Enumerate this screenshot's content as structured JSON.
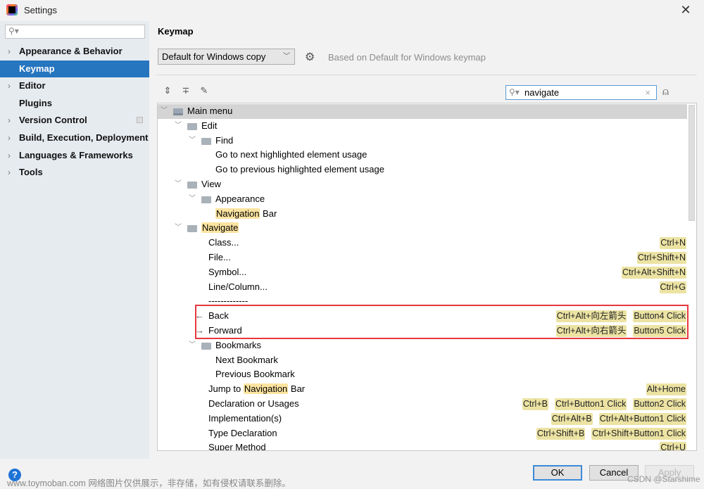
{
  "window": {
    "title": "Settings",
    "close_icon": "close-icon"
  },
  "sidebar": {
    "search_placeholder": "",
    "items": [
      {
        "label": "Appearance & Behavior",
        "expandable": true,
        "selected": false
      },
      {
        "label": "Keymap",
        "expandable": false,
        "selected": true
      },
      {
        "label": "Editor",
        "expandable": true,
        "selected": false
      },
      {
        "label": "Plugins",
        "expandable": false,
        "selected": false
      },
      {
        "label": "Version Control",
        "expandable": true,
        "selected": false,
        "has_project_icon": true
      },
      {
        "label": "Build, Execution, Deployment",
        "expandable": true,
        "selected": false
      },
      {
        "label": "Languages & Frameworks",
        "expandable": true,
        "selected": false
      },
      {
        "label": "Tools",
        "expandable": true,
        "selected": false
      }
    ]
  },
  "main": {
    "title": "Keymap",
    "keymap_select": "Default for Windows copy",
    "based_on": "Based on Default for Windows keymap",
    "filter": {
      "value": "navigate",
      "placeholder": ""
    },
    "tool_icons": [
      "expand-all-icon",
      "collapse-all-icon",
      "edit-icon"
    ],
    "tree": [
      {
        "depth": 0,
        "toggle": true,
        "folder": "main",
        "parts": [
          {
            "t": "Main menu"
          }
        ],
        "selected": true
      },
      {
        "depth": 1,
        "toggle": true,
        "folder": "folder",
        "parts": [
          {
            "t": "Edit"
          }
        ]
      },
      {
        "depth": 2,
        "toggle": true,
        "folder": "folder",
        "parts": [
          {
            "t": "Find"
          }
        ]
      },
      {
        "depth": 3,
        "parts": [
          {
            "t": "Go to next highlighted element usage"
          }
        ]
      },
      {
        "depth": 3,
        "parts": [
          {
            "t": "Go to previous highlighted element usage"
          }
        ]
      },
      {
        "depth": 1,
        "toggle": true,
        "folder": "folder",
        "parts": [
          {
            "t": "View"
          }
        ]
      },
      {
        "depth": 2,
        "toggle": true,
        "folder": "folder",
        "parts": [
          {
            "t": "Appearance"
          }
        ]
      },
      {
        "depth": 3,
        "parts": [
          {
            "t": "Navigation",
            "hl": true
          },
          {
            "t": " Bar"
          }
        ]
      },
      {
        "depth": 1,
        "toggle": true,
        "folder": "folder",
        "parts": [
          {
            "t": "Navigate",
            "hl": true
          }
        ]
      },
      {
        "depth": 2.5,
        "parts": [
          {
            "t": "Class..."
          }
        ],
        "shortcuts": [
          "Ctrl+N"
        ]
      },
      {
        "depth": 2.5,
        "parts": [
          {
            "t": "File..."
          }
        ],
        "shortcuts": [
          "Ctrl+Shift+N"
        ]
      },
      {
        "depth": 2.5,
        "parts": [
          {
            "t": "Symbol..."
          }
        ],
        "shortcuts": [
          "Ctrl+Alt+Shift+N"
        ]
      },
      {
        "depth": 2.5,
        "parts": [
          {
            "t": "Line/Column..."
          }
        ],
        "shortcuts": [
          "Ctrl+G"
        ]
      },
      {
        "depth": 2.5,
        "parts": [
          {
            "t": "-------------"
          }
        ]
      },
      {
        "depth": 2.5,
        "icon": "←",
        "parts": [
          {
            "t": "Back"
          }
        ],
        "shortcuts": [
          "Ctrl+Alt+向左箭头",
          "Button4 Click"
        ]
      },
      {
        "depth": 2.5,
        "icon": "→",
        "parts": [
          {
            "t": "Forward"
          }
        ],
        "shortcuts": [
          "Ctrl+Alt+向右箭头",
          "Button5 Click"
        ]
      },
      {
        "depth": 2,
        "toggle": true,
        "folder": "folder",
        "parts": [
          {
            "t": "Bookmarks"
          }
        ]
      },
      {
        "depth": 3,
        "parts": [
          {
            "t": "Next Bookmark"
          }
        ]
      },
      {
        "depth": 3,
        "parts": [
          {
            "t": "Previous Bookmark"
          }
        ]
      },
      {
        "depth": 2.5,
        "parts": [
          {
            "t": "Jump to "
          },
          {
            "t": "Navigation",
            "hl": true
          },
          {
            "t": " Bar"
          }
        ],
        "shortcuts": [
          "Alt+Home"
        ]
      },
      {
        "depth": 2.5,
        "parts": [
          {
            "t": "Declaration or Usages"
          }
        ],
        "shortcuts": [
          "Ctrl+B",
          "Ctrl+Button1 Click",
          "Button2 Click"
        ]
      },
      {
        "depth": 2.5,
        "parts": [
          {
            "t": "Implementation(s)"
          }
        ],
        "shortcuts": [
          "Ctrl+Alt+B",
          "Ctrl+Alt+Button1 Click"
        ]
      },
      {
        "depth": 2.5,
        "parts": [
          {
            "t": "Type Declaration"
          }
        ],
        "shortcuts": [
          "Ctrl+Shift+B",
          "Ctrl+Shift+Button1 Click"
        ]
      },
      {
        "depth": 2.5,
        "parts": [
          {
            "t": "Super Method"
          }
        ],
        "shortcuts": [
          "Ctrl+U"
        ]
      }
    ]
  },
  "footer": {
    "help": "?",
    "ok": "OK",
    "cancel": "Cancel",
    "apply": "Apply",
    "watermark": "www.toymoban.com 网络图片仅供展示，非存储，如有侵权请联系删除。",
    "credit": "CSDN @Starshime"
  },
  "colors": {
    "selection": "#2675bf",
    "highlight": "#fbe4a0",
    "shortcut_bg": "#ece3a3",
    "annotation_box": "#e8383d"
  }
}
